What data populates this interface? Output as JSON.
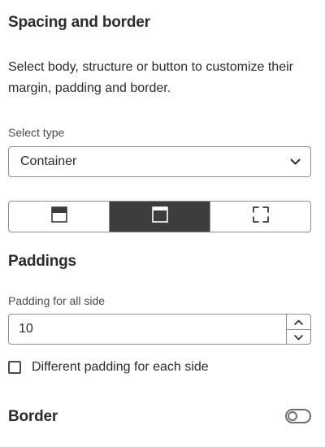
{
  "panel": {
    "title": "Spacing and border",
    "description": "Select body, structure or button to customize their margin, padding and border."
  },
  "select_type": {
    "label": "Select type",
    "value": "Container"
  },
  "segments": {
    "items": [
      {
        "name": "body",
        "icon": "layout-header-icon"
      },
      {
        "name": "structure",
        "icon": "layout-frame-icon",
        "selected": true
      },
      {
        "name": "button",
        "icon": "crop-corners-icon"
      }
    ]
  },
  "paddings": {
    "title": "Paddings",
    "label": "Padding for all side",
    "value": "10",
    "checkbox_label": "Different padding for each side",
    "checkbox_checked": false
  },
  "border": {
    "title": "Border",
    "toggle_on": false
  },
  "colors": {
    "text": "#2c2c2c",
    "border": "#8e8e8e",
    "active_segment": "#3c3c3c"
  }
}
